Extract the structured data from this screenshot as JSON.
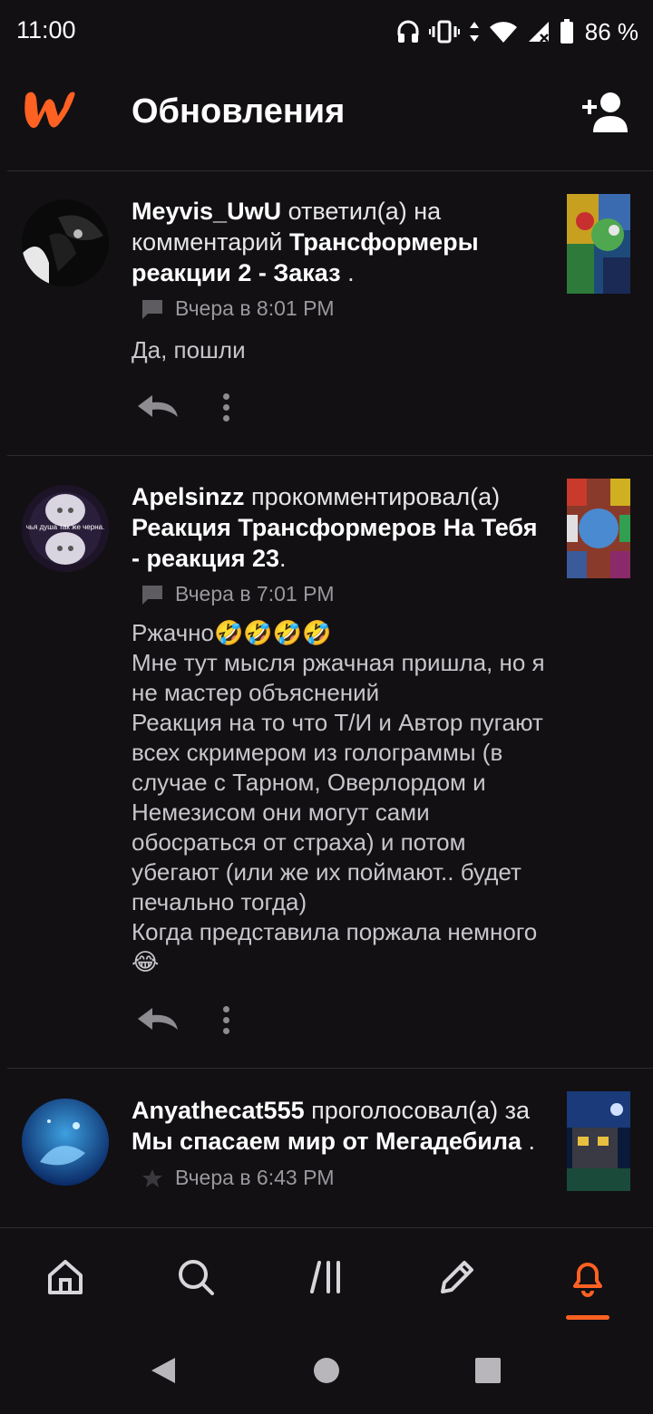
{
  "status_bar": {
    "time": "11:00",
    "battery": "86 %"
  },
  "header": {
    "title": "Обновления",
    "add_user_icon": "person-add-icon",
    "logo_icon": "wattpad-logo-icon"
  },
  "notifications": [
    {
      "user": "Meyvis_UwU",
      "action": "ответил(а) на комментарий",
      "story": "Трансформеры реакции 2 - Заказ",
      "suffix": ".",
      "time": "Вчера в 8:01 PM",
      "meta_icon": "comment-icon",
      "text": "Да, пошли"
    },
    {
      "user": "Apelsinzz",
      "action": "прокомментировал(а)",
      "story": "Реакция Трансформеров На Тебя - реакция 23",
      "suffix": ".",
      "time": "Вчера в 7:01 PM",
      "meta_icon": "comment-icon",
      "avatar_caption": "чья душа так же черна.",
      "text": "Ржачно🤣🤣🤣🤣\nМне тут мысля ржачная пришла, но я не мастер объяснений\nРеакция на то что Т/И и Автор пугают всех скримером из голограммы (в случае с Тарном, Оверлордом и Немезисом они могут сами обосраться от страха) и потом убегают (или же их поймают.. будет печально тогда)\nКогда представила поржала немного😂"
    },
    {
      "user": "Anyathecat555",
      "action": "проголосовал(а) за",
      "story": "Мы спасаем мир от Мегадебила",
      "suffix": ".",
      "time": "Вчера в 6:43 PM",
      "meta_icon": "star-icon"
    }
  ],
  "bottom_nav": [
    "home-icon",
    "search-icon",
    "library-icon",
    "write-icon",
    "notifications-icon"
  ],
  "colors": {
    "background": "#121013",
    "accent": "#ff6122",
    "muted": "#9a989c"
  }
}
